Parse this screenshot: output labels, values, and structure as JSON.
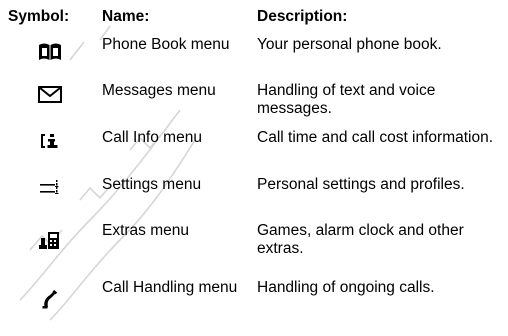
{
  "headers": {
    "symbol": "Symbol:",
    "name": "Name:",
    "description": "Description:"
  },
  "rows": [
    {
      "icon": "phone-book-icon",
      "name": "Phone Book menu",
      "description": "Your personal phone book."
    },
    {
      "icon": "messages-envelope-icon",
      "name": "Messages menu",
      "description": "Handling of text and voice messages."
    },
    {
      "icon": "call-info-icon",
      "name": "Call Info menu",
      "description": "Call time and call cost information."
    },
    {
      "icon": "settings-icon",
      "name": "Settings menu",
      "description": "Personal settings and profiles."
    },
    {
      "icon": "extras-icon",
      "name": "Extras menu",
      "description": "Games, alarm clock and other extras."
    },
    {
      "icon": "call-handling-icon",
      "name": "Call Handling menu",
      "description": "Handling of ongoing calls."
    }
  ]
}
